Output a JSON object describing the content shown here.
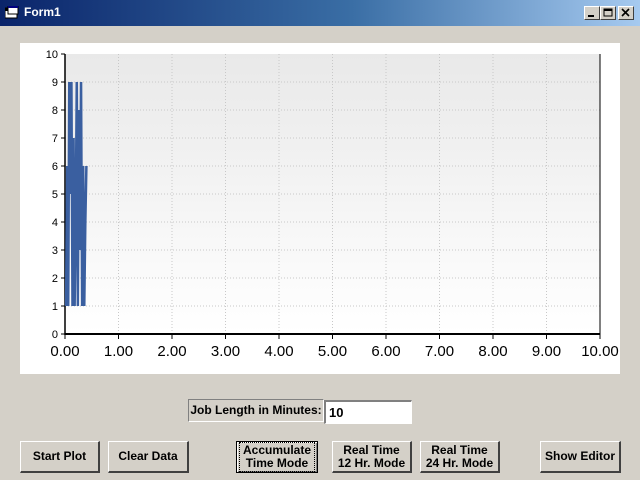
{
  "window": {
    "title": "Form1"
  },
  "titlebar_buttons": {
    "minimize_icon": "minimize-icon",
    "maximize_icon": "maximize-icon",
    "close_icon": "close-icon"
  },
  "chart_data": {
    "type": "line",
    "xlim": [
      0,
      10
    ],
    "ylim": [
      0,
      10
    ],
    "x_ticks": [
      "0.00",
      "1.00",
      "2.00",
      "3.00",
      "4.00",
      "5.00",
      "6.00",
      "7.00",
      "8.00",
      "9.00",
      "10.00"
    ],
    "y_ticks": [
      "0",
      "1",
      "2",
      "3",
      "4",
      "5",
      "6",
      "7",
      "8",
      "9",
      "10"
    ],
    "grid": true,
    "series": [
      {
        "color": "#3a5fa0",
        "x": [
          0.02,
          0.04,
          0.06,
          0.08,
          0.1,
          0.12,
          0.14,
          0.16,
          0.18,
          0.2,
          0.22,
          0.24,
          0.26,
          0.28,
          0.3,
          0.32,
          0.34,
          0.36,
          0.38,
          0.4
        ],
        "y": [
          1,
          6,
          1,
          9,
          5,
          9,
          1,
          7,
          1,
          4,
          9,
          1,
          8,
          3,
          9,
          1,
          6,
          1,
          4,
          6
        ]
      }
    ]
  },
  "job_length": {
    "label": "Job Length in Minutes:",
    "value": "10"
  },
  "buttons": {
    "start_plot": "Start Plot",
    "clear_data": "Clear Data",
    "accumulate": "Accumulate\nTime Mode",
    "realtime12": "Real Time\n12 Hr. Mode",
    "realtime24": "Real Time\n24 Hr. Mode",
    "show_editor": "Show Editor"
  }
}
